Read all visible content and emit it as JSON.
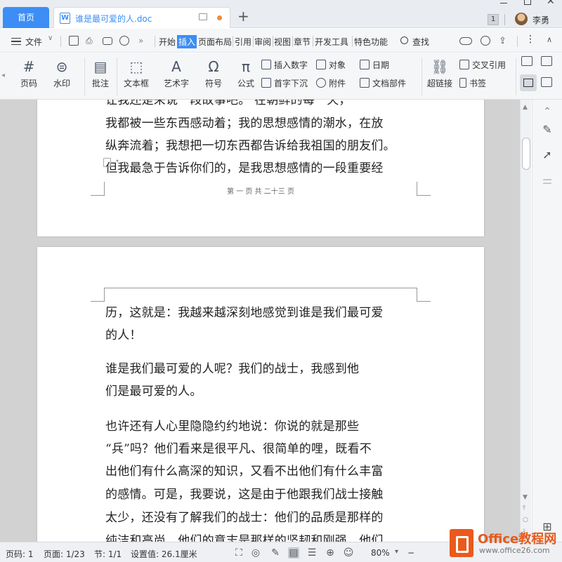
{
  "titlebar": {
    "home_tab": "首页",
    "doc_tab": "谁是最可爱的人.doc",
    "new_tab": "+",
    "badge": "1",
    "username": "李勇"
  },
  "menubar": {
    "file": "文件",
    "more": "»",
    "tabs": [
      "开始",
      "插入",
      "页面布局",
      "引用",
      "审阅",
      "视图",
      "章节",
      "开发工具",
      "特色功能"
    ],
    "active_tab": "插入",
    "search": "查找"
  },
  "ribbon": {
    "page_num": "页码",
    "watermark": "水印",
    "comment": "批注",
    "textbox": "文本框",
    "wordart": "艺术字",
    "symbol": "符号",
    "formula": "公式",
    "insert_number": "插入数字",
    "dropcap": "首字下沉",
    "object": "对象",
    "attachment": "附件",
    "date": "日期",
    "doc_parts": "文档部件",
    "hyperlink": "超链接",
    "crossref": "交叉引用",
    "bookmark": "书签"
  },
  "document": {
    "page1_lines": [
      "让我还是来说一段故事吧。    在朝鲜的每一天，",
      "我都被一些东西感动着；我的思想感情的潮水，在放",
      "纵奔流着；我想把一切东西都告诉给我祖国的朋友们。",
      "但我最急于告诉你们的，是我思想感情的一段重要经"
    ],
    "page1_footer": "第 一 页 共 二十三 页",
    "page2_paragraphs": [
      [
        "历，这就是：我越来越深刻地感觉到谁是我们最可爱",
        "的人！"
      ],
      [
        "    谁是我们最可爱的人呢？我们的战士，我感到他",
        "们是最可爱的人。"
      ],
      [
        "    也许还有人心里隐隐约约地说：你说的就是那些",
        "“兵”吗？他们看来是很平凡、很简单的哩，既看不",
        "出他们有什么高深的知识，又看不出他们有什么丰富",
        "的感情。可是，我要说，这是由于他跟我们战士接触",
        "太少，还没有了解我们的战士：他们的品质是那样的",
        "纯洁和高尚，他们的意志是那样的坚韧和刚强，他们"
      ]
    ]
  },
  "statusbar": {
    "page_code": "页码: 1",
    "page": "页面: 1/23",
    "section": "节: 1/1",
    "setting": "设置值: 26.1厘米",
    "zoom": "80%"
  },
  "watermark": {
    "title": "Office教程网",
    "url": "www.office26.com"
  },
  "colors": {
    "accent": "#3c8ef5",
    "watermark_orange": "#e55a1c"
  }
}
